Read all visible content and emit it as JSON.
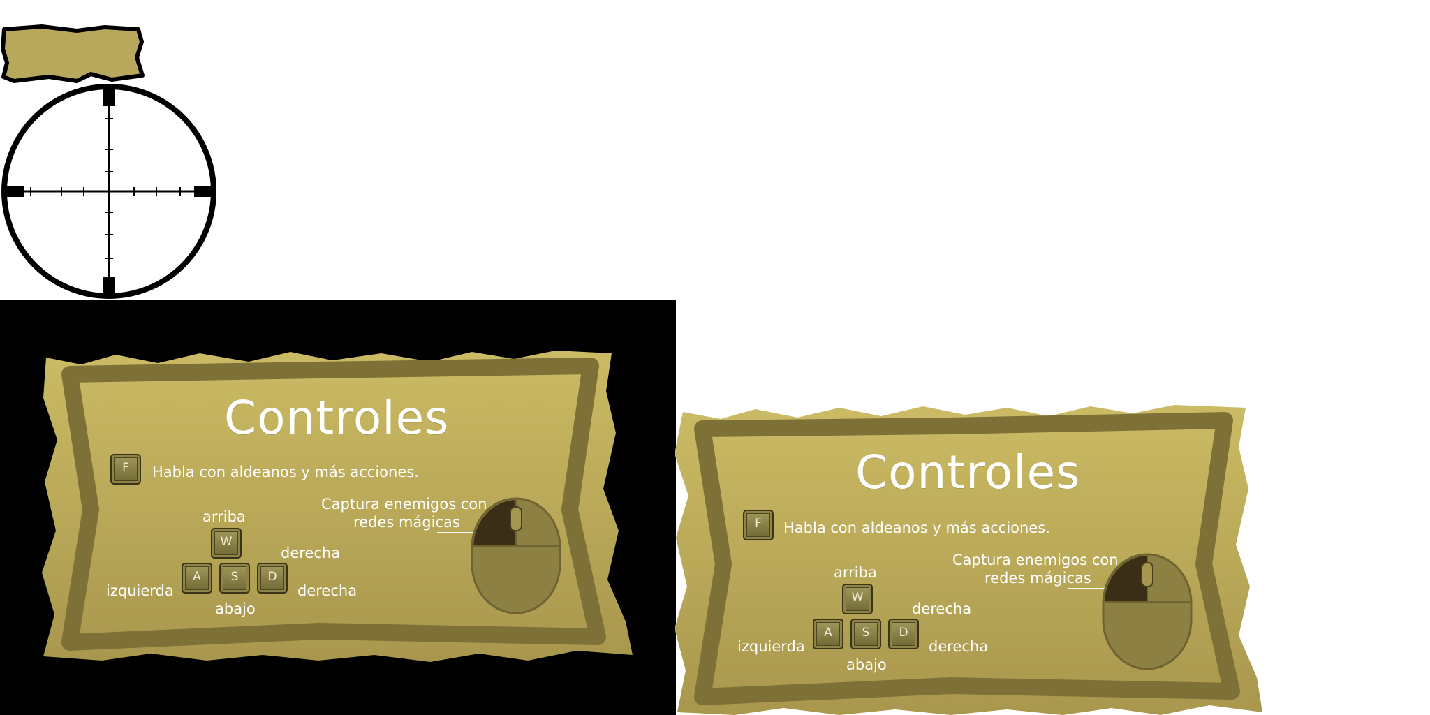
{
  "panels": [
    {
      "title": "Controles",
      "f_key": "F",
      "f_action": "Habla con aldeanos y más acciones.",
      "mouse_action_line1": "Captura enemigos con",
      "mouse_action_line2": "redes mágicas",
      "keys": {
        "w": "W",
        "a": "A",
        "s": "S",
        "d": "D"
      },
      "labels": {
        "up": "arriba",
        "down": "abajo",
        "left": "izquierda",
        "right_top": "derecha",
        "right_bottom": "derecha"
      }
    },
    {
      "title": "Controles",
      "f_key": "F",
      "f_action": "Habla con aldeanos y más acciones.",
      "mouse_action_line1": "Captura enemigos con",
      "mouse_action_line2": "redes mágicas",
      "keys": {
        "w": "W",
        "a": "A",
        "s": "S",
        "d": "D"
      },
      "labels": {
        "up": "arriba",
        "down": "abajo",
        "left": "izquierda",
        "right_top": "derecha",
        "right_bottom": "derecha"
      }
    }
  ],
  "colors": {
    "parchment": "#c2b15d",
    "parchment_border": "#8a7b3e",
    "ink": "#ffffff",
    "plank": "#b7a85c"
  },
  "icons": [
    "sign-plank-icon",
    "crosshair-icon",
    "key-icon",
    "mouse-icon"
  ]
}
